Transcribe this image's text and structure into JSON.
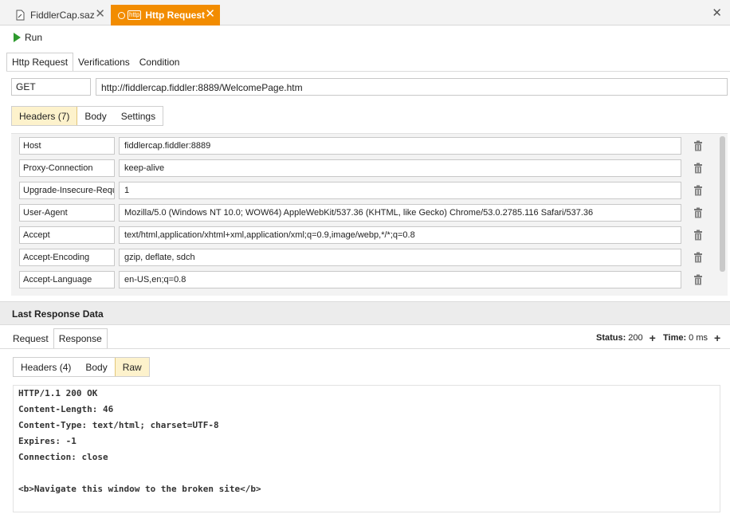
{
  "doc_tabs": [
    {
      "label": "FiddlerCap.saz",
      "active": false
    },
    {
      "label": "Http Request",
      "active": true,
      "badge": "http"
    }
  ],
  "toolbar": {
    "run_label": "Run"
  },
  "request_tabs": [
    "Http Request",
    "Verifications",
    "Condition"
  ],
  "request": {
    "method": "GET",
    "url": "http://fiddlercap.fiddler:8889/WelcomePage.htm"
  },
  "request_subtabs": [
    "Headers (7)",
    "Body",
    "Settings"
  ],
  "headers": [
    {
      "name": "Host",
      "value": "fiddlercap.fiddler:8889"
    },
    {
      "name": "Proxy-Connection",
      "value": "keep-alive"
    },
    {
      "name": "Upgrade-Insecure-Requ",
      "value": "1"
    },
    {
      "name": "User-Agent",
      "value": "Mozilla/5.0 (Windows NT 10.0; WOW64) AppleWebKit/537.36 (KHTML, like Gecko) Chrome/53.0.2785.116 Safari/537.36"
    },
    {
      "name": "Accept",
      "value": "text/html,application/xhtml+xml,application/xml;q=0.9,image/webp,*/*;q=0.8"
    },
    {
      "name": "Accept-Encoding",
      "value": "gzip, deflate, sdch"
    },
    {
      "name": "Accept-Language",
      "value": "en-US,en;q=0.8"
    }
  ],
  "last_response": {
    "title": "Last Response Data",
    "tabs": [
      "Request",
      "Response"
    ],
    "status_label": "Status:",
    "status_value": "200",
    "time_label": "Time:",
    "time_value": "0 ms",
    "subtabs": [
      "Headers (4)",
      "Body",
      "Raw"
    ],
    "raw_lines": [
      "HTTP/1.1 200 OK",
      "Content-Length: 46",
      "Content-Type: text/html; charset=UTF-8",
      "Expires: -1",
      "Connection: close",
      "",
      "<b>Navigate this window to the broken site</b>"
    ]
  },
  "colors": {
    "accent": "#f28c00",
    "selected_segment": "#fdf2cc",
    "run_icon": "#2e9a2e"
  }
}
